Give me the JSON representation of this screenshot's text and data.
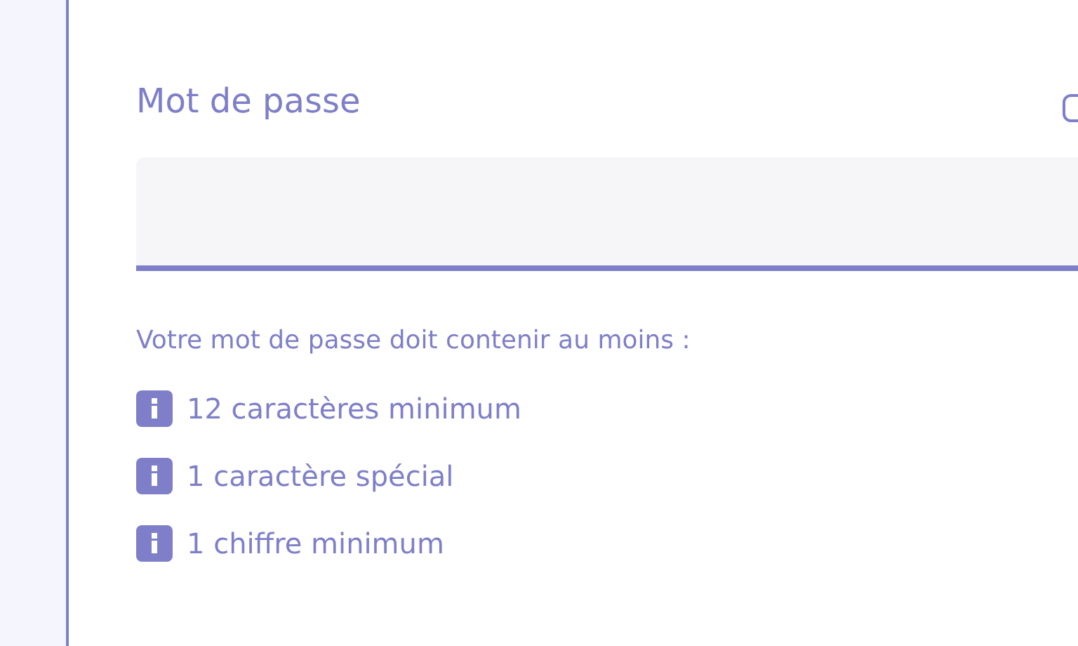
{
  "field": {
    "label": "Mot de passe",
    "show_password": {
      "checked": false
    }
  },
  "hint": "Votre mot de passe doit contenir au moins :",
  "requirements": [
    {
      "text": "12 caractères minimum",
      "kind": "info"
    },
    {
      "text": "1 caractère spécial",
      "kind": "info"
    },
    {
      "text": "1 chiffre minimum",
      "kind": "info"
    }
  ]
}
